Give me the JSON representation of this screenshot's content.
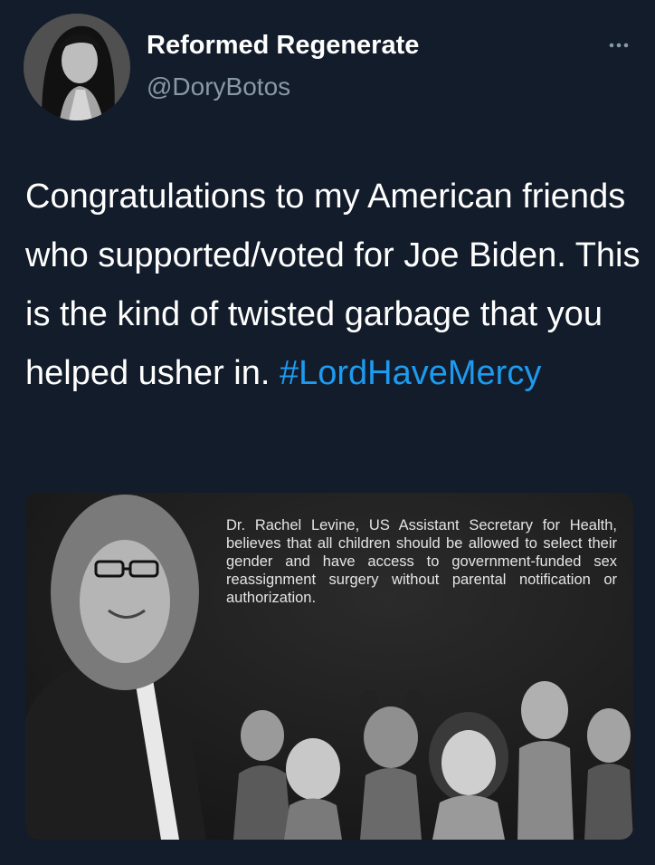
{
  "tweet": {
    "author": {
      "display_name": "Reformed Regenerate",
      "handle": "@DoryBotos"
    },
    "more_icon": "more-horizontal-icon",
    "text": "Congratulations to my American friends who supported/voted for Joe Biden. This is the kind of twisted garbage that you helped usher in.",
    "hashtag": "#LordHaveMercy",
    "media": {
      "caption": "Dr. Rachel Levine, US Assistant Secretary for Health, believes that all children should be allowed to select their gender and have access to government-funded sex reassignment surgery without parental notification or authorization."
    }
  },
  "colors": {
    "background": "#131c2a",
    "text": "#ffffff",
    "secondary_text": "#8899a6",
    "link": "#1d9bf0"
  }
}
